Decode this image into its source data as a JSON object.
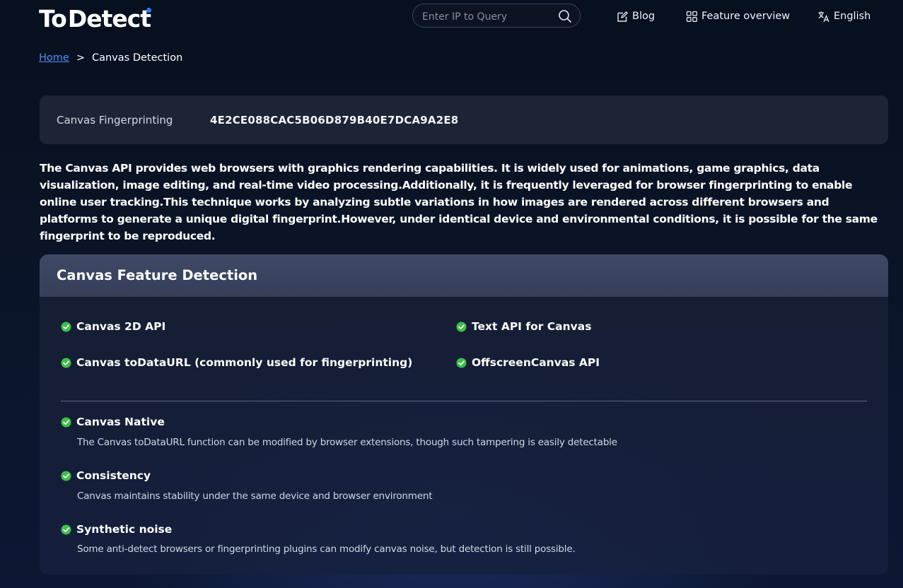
{
  "header": {
    "logo_to": "To",
    "logo_detect": "Detect",
    "search_placeholder": "Enter IP to Query",
    "nav": {
      "blog": "Blog",
      "feature_overview": "Feature overview",
      "language": "English"
    }
  },
  "breadcrumb": {
    "home": "Home",
    "separator": ">",
    "current": "Canvas Detection"
  },
  "fingerprint": {
    "label": "Canvas Fingerprinting",
    "value": "4E2CE088CAC5B06D879B40E7DCA9A2E8"
  },
  "description": "The Canvas API provides web browsers with graphics rendering capabilities. It is widely used for animations, game graphics, data visualization, image editing, and real-time video processing.Additionally, it is frequently leveraged for browser fingerprinting to enable online user tracking.This technique works by analyzing subtle variations in how images are rendered across different browsers and platforms to generate a unique digital fingerprint.However, under identical device and environmental conditions, it is possible for the same fingerprint to be reproduced.",
  "feature_detection": {
    "title": "Canvas Feature Detection",
    "api_checks": [
      {
        "label": "Canvas 2D API",
        "status": "pass"
      },
      {
        "label": "Text API for Canvas",
        "status": "pass"
      },
      {
        "label": "Canvas toDataURL (commonly used for fingerprinting)",
        "status": "pass"
      },
      {
        "label": "OffscreenCanvas API",
        "status": "pass"
      }
    ],
    "details": [
      {
        "title": "Canvas Native",
        "description": "The Canvas toDataURL function can be modified by browser extensions, though such tampering is easily detectable",
        "status": "pass"
      },
      {
        "title": "Consistency",
        "description": "Canvas maintains stability under the same device and browser environment",
        "status": "pass"
      },
      {
        "title": "Synthetic noise",
        "description": "Some anti-detect browsers or fingerprinting plugins can modify canvas noise, but detection is still possible.",
        "status": "pass"
      }
    ]
  },
  "colors": {
    "accent": "#2f7bf5",
    "link": "#4f8ff7",
    "check": "#3fbf4a"
  }
}
